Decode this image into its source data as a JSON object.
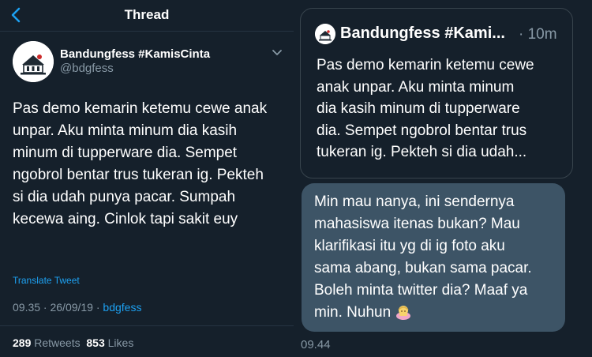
{
  "colors": {
    "background": "#15202b",
    "accent": "#1da1f2",
    "secondary_text": "#8899a6",
    "bubble": "#3d5466"
  },
  "header": {
    "title": "Thread",
    "back_icon": "chevron-left-icon"
  },
  "tweet": {
    "author_name": "Bandungfess #KamisCinta",
    "author_handle": "@bdgfess",
    "lines": [
      "Pas demo kemarin ketemu cewe anak",
      "unpar. Aku minta minum dia kasih",
      "minum di tupperware dia. Sempet",
      "ngobrol bentar trus tukeran ig. Pekteh",
      "si dia udah punya pacar. Sumpah",
      "kecewa aing. Cinlok tapi sakit euy"
    ],
    "translate_label": "Translate Tweet",
    "meta_time": "09.35 · 26/09/19 · ",
    "meta_source": "bdgfess",
    "retweets_count": "289",
    "retweets_label": "Retweets",
    "likes_count": "853",
    "likes_label": "Likes"
  },
  "dm": {
    "quote": {
      "author_name": "Bandungfess #Kami...",
      "time": "· 10m",
      "lines": [
        "Pas demo kemarin ketemu cewe",
        "anak unpar. Aku minta minum",
        "dia kasih minum di tupperware",
        "dia. Sempet ngobrol bentar trus",
        "tukeran ig. Pekteh si dia udah..."
      ]
    },
    "message": {
      "lines": [
        "Min mau nanya, ini sendernya",
        "mahasiswa itenas bukan? Mau",
        "klarifikasi itu yg di ig foto aku",
        "sama abang, bukan sama pacar.",
        "Boleh minta twitter dia? Maaf ya",
        "min. Nuhun"
      ],
      "emoji": "person-bowing-emoji",
      "time": "09.44"
    }
  }
}
